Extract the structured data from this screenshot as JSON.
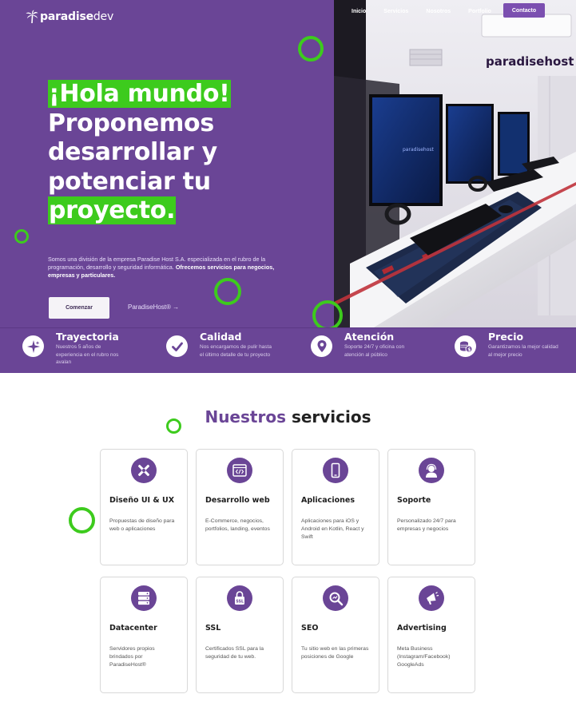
{
  "brand": {
    "logo_bold": "paradise",
    "logo_thin": "dev"
  },
  "nav": {
    "items": [
      "Inicio",
      "Servicios",
      "Nosotros",
      "Portfolio"
    ],
    "cta": "Contacto"
  },
  "hero": {
    "line1": "¡Hola mundo!",
    "line2": "Proponemos",
    "line3": "desarrollar y",
    "line4": "potenciar tu",
    "line5": "proyecto.",
    "desc_plain": "Somos una división de la empresa Paradise Host S.A. especializada en el rubro de la programación, desarrollo y seguridad informática.",
    "desc_bold": "Ofrecemos servicios para negocios, empresas y particulares.",
    "start_button": "Comenzar",
    "secondary_link": "ParadiseHost® →",
    "photo_sign": "paradisehost",
    "accent_color": "#3dcb1d",
    "brand_color": "#6a4596"
  },
  "features": [
    {
      "icon": "sparkle-icon",
      "title": "Trayectoria",
      "text": "Nuestros 5 años de experiencia en el rubro nos avalan"
    },
    {
      "icon": "check-icon",
      "title": "Calidad",
      "text": "Nos encargamos de pulir hasta el último detalle de tu proyecto"
    },
    {
      "icon": "location-icon",
      "title": "Atención",
      "text": "Soporte 24/7 y oficina con atención al público"
    },
    {
      "icon": "coins-icon",
      "title": "Precio",
      "text": "Garantizamos la mejor calidad al mejor precio"
    }
  ],
  "services": {
    "title_accent": "Nuestros",
    "title_rest": "servicios",
    "items": [
      {
        "icon": "design-tools-icon",
        "title": "Diseño UI & UX",
        "text": "Propuestas de diseño para web o aplicaciones"
      },
      {
        "icon": "code-window-icon",
        "title": "Desarrollo web",
        "text": "E-Commerce, negocios, portfolios, landing, eventos"
      },
      {
        "icon": "smartphone-icon",
        "title": "Aplicaciones",
        "text": "Aplicaciones para iOS y Android en Kotlin, React y Swift"
      },
      {
        "icon": "headset-icon",
        "title": "Soporte",
        "text": "Personalizado 24/7 para empresas y negocios"
      },
      {
        "icon": "server-icon",
        "title": "Datacenter",
        "text": "Servidores propios brindados por ParadiseHost®"
      },
      {
        "icon": "ssl-lock-icon",
        "title": "SSL",
        "text": "Certificados SSL para la seguridad de tu web."
      },
      {
        "icon": "seo-search-icon",
        "title": "SEO",
        "text": "Tu sitio web en las primeras posiciones de Google"
      },
      {
        "icon": "megaphone-icon",
        "title": "Advertising",
        "text": "Meta Business (Instagram/Facebook) GoogleAds"
      }
    ]
  }
}
